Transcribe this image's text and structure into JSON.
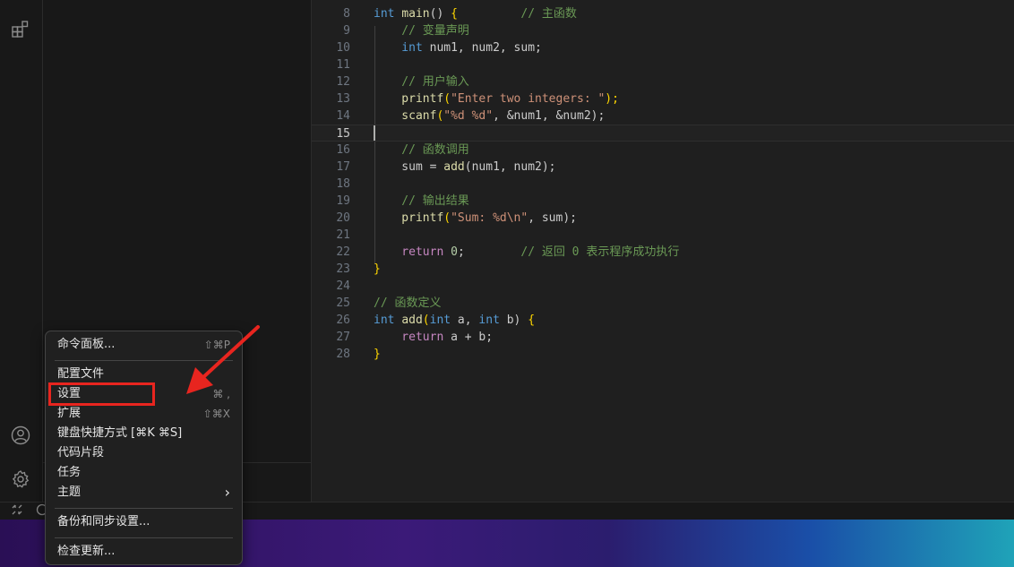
{
  "editor": {
    "current_line": 15,
    "lines": [
      {
        "n": "8"
      },
      {
        "n": "9"
      },
      {
        "n": "10"
      },
      {
        "n": "11"
      },
      {
        "n": "12"
      },
      {
        "n": "13"
      },
      {
        "n": "14"
      },
      {
        "n": "15"
      },
      {
        "n": "16"
      },
      {
        "n": "17"
      },
      {
        "n": "18"
      },
      {
        "n": "19"
      },
      {
        "n": "20"
      },
      {
        "n": "21"
      },
      {
        "n": "22"
      },
      {
        "n": "23"
      },
      {
        "n": "24"
      },
      {
        "n": "25"
      },
      {
        "n": "26"
      },
      {
        "n": "27"
      },
      {
        "n": "28"
      }
    ],
    "code": {
      "l8_int": "int",
      "l8_main": "main",
      "l8_paren": "() ",
      "l8_brace": "{",
      "l8_comment": "         // 主函数",
      "l9_comment": "    // 变量声明",
      "l10_int": "    int",
      "l10_rest": " num1, num2, sum;",
      "l12_comment": "    // 用户输入",
      "l13_fn": "    printf",
      "l13_open": "(",
      "l13_str": "\"Enter two integers: \"",
      "l13_close": ");",
      "l14_fn": "    scanf",
      "l14_open": "(",
      "l14_str": "\"%d %d\"",
      "l14_rest": ", &num1, &num2);",
      "l16_comment": "    // 函数调用",
      "l17_a": "    sum = ",
      "l17_fn": "add",
      "l17_rest": "(num1, num2);",
      "l19_comment": "    // 输出结果",
      "l20_fn": "    printf",
      "l20_open": "(",
      "l20_str": "\"Sum: %d\\n\"",
      "l20_rest": ", sum);",
      "l22_kw": "    return",
      "l22_sp": " ",
      "l22_num": "0",
      "l22_semi": ";",
      "l22_comment": "        // 返回 0 表示程序成功执行",
      "l23_brace": "}",
      "l25_comment": "// 函数定义",
      "l26_int": "int",
      "l26_sp": " ",
      "l26_fn": "add",
      "l26_open": "(",
      "l26_int2": "int",
      "l26_a": " a, ",
      "l26_int3": "int",
      "l26_b": " b) ",
      "l26_brace": "{",
      "l27_kw": "    return",
      "l27_rest": " a + b;",
      "l28_brace": "}"
    }
  },
  "activity_bar": {
    "top_icons": [
      "extensions-icon"
    ],
    "bottom_icons": [
      "account-icon",
      "gear-icon"
    ]
  },
  "context_menu": {
    "command_palette": {
      "label": "命令面板...",
      "shortcut": "⇧⌘P"
    },
    "profiles": {
      "label": "配置文件"
    },
    "settings": {
      "label": "设置",
      "shortcut": "⌘ ,"
    },
    "extensions": {
      "label": "扩展",
      "shortcut": "⇧⌘X"
    },
    "keyboard_shortcuts": {
      "label": "键盘快捷方式 [⌘K ⌘S]"
    },
    "snippets": {
      "label": "代码片段"
    },
    "tasks": {
      "label": "任务"
    },
    "themes": {
      "label": "主题",
      "submenu_glyph": "›"
    },
    "backup_sync": {
      "label": "备份和同步设置..."
    },
    "check_updates": {
      "label": "检查更新..."
    }
  },
  "annotation": {
    "highlight_color": "#e8251f"
  },
  "colors": {
    "keyword": "#c586c0",
    "type": "#569cd6",
    "function": "#dcdcaa",
    "string": "#ce9178",
    "comment": "#6a9955",
    "number": "#b5cea8",
    "bracket": "#ffd700"
  }
}
